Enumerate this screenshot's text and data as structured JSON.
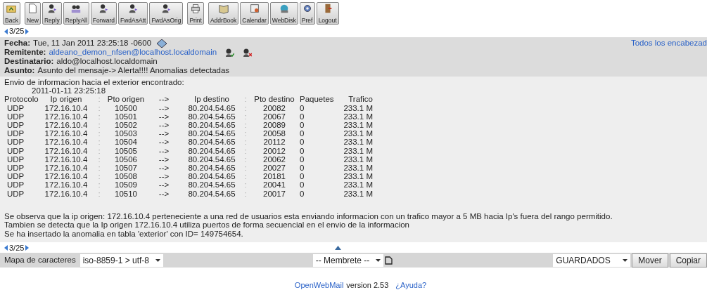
{
  "toolbar": [
    [
      "Back"
    ],
    [
      "New",
      "Reply",
      "ReplyAll",
      "Forward",
      "FwdAsAtt",
      "FwdAsOrig"
    ],
    [
      "Print"
    ],
    [
      "AddrBook",
      "Calendar",
      "WebDisk",
      "Pref",
      "Logout"
    ]
  ],
  "pager_top": "3/25",
  "all_headers_link": "Todos los encabezad",
  "headers": [
    {
      "label": "Fecha:",
      "value": "Tue, 11 Jan 2011 23:25:18 -0600",
      "kind": "date"
    },
    {
      "label": "Remitente:",
      "value": "aldeano_demon_nfsen@localhost.localdomain",
      "kind": "sender"
    },
    {
      "label": "Destinatario:",
      "value": "aldo@localhost.localdomain",
      "kind": "plain"
    },
    {
      "label": "Asunto:",
      "value": "Asunto del mensaje-> Alerta!!!! Anomalias detectadas",
      "kind": "plain"
    }
  ],
  "body": {
    "intro": "Envio de informacion hacia el exterior encontrado:",
    "timestamp": "2011-01-11 23:25:18",
    "table": {
      "columns": [
        "Protocolo",
        "Ip origen",
        ":",
        "Pto origen",
        "-->",
        "Ip destino",
        ":",
        "Pto destino",
        "Paquetes",
        "Trafico"
      ],
      "rows": [
        [
          "UDP",
          "172.16.10.4",
          ":",
          "10500",
          "-->",
          "80.204.54.65",
          ":",
          "20082",
          "0",
          "233.1 M"
        ],
        [
          "UDP",
          "172.16.10.4",
          ":",
          "10501",
          "-->",
          "80.204.54.65",
          ":",
          "20067",
          "0",
          "233.1 M"
        ],
        [
          "UDP",
          "172.16.10.4",
          ":",
          "10502",
          "-->",
          "80.204.54.65",
          ":",
          "20089",
          "0",
          "233.1 M"
        ],
        [
          "UDP",
          "172.16.10.4",
          ":",
          "10503",
          "-->",
          "80.204.54.65",
          ":",
          "20058",
          "0",
          "233.1 M"
        ],
        [
          "UDP",
          "172.16.10.4",
          ":",
          "10504",
          "-->",
          "80.204.54.65",
          ":",
          "20112",
          "0",
          "233.1 M"
        ],
        [
          "UDP",
          "172.16.10.4",
          ":",
          "10505",
          "-->",
          "80.204.54.65",
          ":",
          "20012",
          "0",
          "233.1 M"
        ],
        [
          "UDP",
          "172.16.10.4",
          ":",
          "10506",
          "-->",
          "80.204.54.65",
          ":",
          "20062",
          "0",
          "233.1 M"
        ],
        [
          "UDP",
          "172.16.10.4",
          ":",
          "10507",
          "-->",
          "80.204.54.65",
          ":",
          "20027",
          "0",
          "233.1 M"
        ],
        [
          "UDP",
          "172.16.10.4",
          ":",
          "10508",
          "-->",
          "80.204.54.65",
          ":",
          "20181",
          "0",
          "233.1 M"
        ],
        [
          "UDP",
          "172.16.10.4",
          ":",
          "10509",
          "-->",
          "80.204.54.65",
          ":",
          "20041",
          "0",
          "233.1 M"
        ],
        [
          "UDP",
          "172.16.10.4",
          ":",
          "10510",
          "-->",
          "80.204.54.65",
          ":",
          "20017",
          "0",
          "233.1 M"
        ]
      ]
    },
    "notes": [
      "Se observa que la ip origen: 172.16.10.4 perteneciente a una red de usuarios esta enviando informacion con un trafico mayor a 5 MB hacia Ip's fuera del rango permitido.",
      "Tambien se detecta que la Ip origen 172.16.10.4 utiliza puertos de forma secuencial en el envio de la informacion",
      "Se ha insertado la anomalia en tabla 'exterior' con ID= 149754654."
    ]
  },
  "pager_bottom": "3/25",
  "bottom_bar": {
    "charset_label": "Mapa de caracteres",
    "charset_value": "iso-8859-1 > utf-8",
    "letterhead_value": "-- Membrete --",
    "folder_value": "GUARDADOS",
    "buttons": [
      "Mover",
      "Copiar"
    ]
  },
  "footer": {
    "app_link": "OpenWebMail",
    "version": "version 2.53",
    "help_link": "¿Ayuda?"
  }
}
